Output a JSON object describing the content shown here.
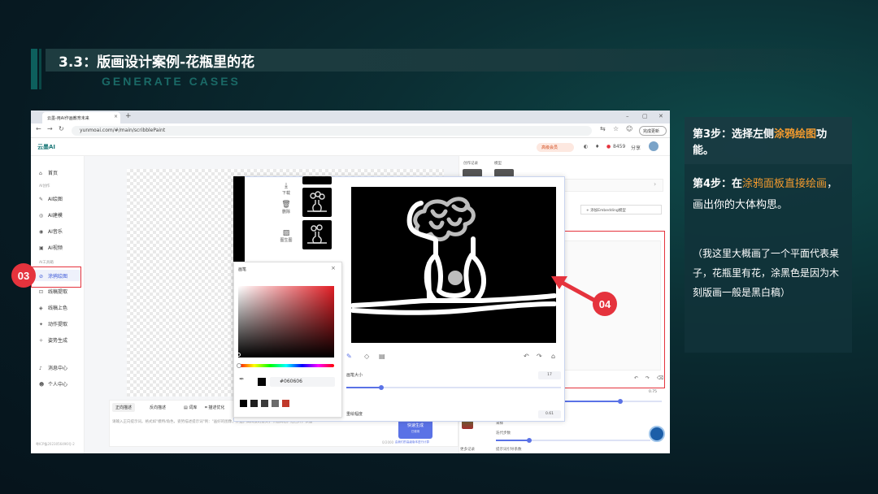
{
  "slide": {
    "title": "3.3：版画设计案例-花瓶里的花",
    "subtitle": "GENERATE CASES"
  },
  "browser": {
    "tab_title": "云墨-用AI作画教育未来",
    "tab_close": "×",
    "new_tab": "+",
    "url": "yunmoai.com/#/main/scribblePaint",
    "profile_button": "完成更新"
  },
  "app": {
    "logo": "云墨AI",
    "vip_button": "高级会员",
    "points": "8459",
    "share": "分享"
  },
  "sidebar": {
    "home": "首页",
    "group_ai_create": "AI创作",
    "items_create": [
      "AI绘图",
      "AI建模",
      "AI音乐",
      "AI视频"
    ],
    "group_ai_tools": "AI工具箱",
    "items_tools": [
      "涂鸦绘图",
      "线稿提取",
      "线稿上色",
      "动作提取",
      "姿势生成"
    ],
    "messages": "消息中心",
    "profile": "个人中心",
    "footer": "粤ICP备2023056496号-2"
  },
  "prompt": {
    "tab_positive": "正向描述",
    "tab_negative": "反向描述",
    "tab_words": "词库",
    "tab_suggest": "描述优化",
    "placeholder": "请输入正向提示词。格式如\"模特/角色，姿势描述提示词\"例：\"画好的图像，外边，高科技的街头，卡通风格，红色外，衣服\"",
    "counter": "0/2000",
    "generate_button": "快速生成",
    "generate_sub": "已使用",
    "generate_hint": "由我们的高级版本进行计算"
  },
  "right_panel": {
    "label_records": "创作记录",
    "label_model": "模型",
    "embed_button": "+ 添加Embedding模型",
    "value_075": "0.75",
    "label_more": "更多记录",
    "label_sampler": "采样",
    "label_steps": "迭代步数",
    "label_guidance": "提示词引导系数"
  },
  "modal": {
    "tool_download": "下载",
    "tool_delete": "删除",
    "tool_generate": "图生图",
    "brush_size_label": "画笔大小",
    "brush_size_value": "17",
    "redraw_label": "重绘幅度",
    "redraw_value": "0.61"
  },
  "color_picker": {
    "title": "画笔",
    "close": "×",
    "hex": "#060606",
    "presets": [
      "#000000",
      "#1f1f1f",
      "#3a3a3a",
      "#6b6b6b",
      "#c0392b"
    ]
  },
  "annotations": {
    "label_03": "03",
    "label_04": "04"
  },
  "instructions": {
    "step3_prefix": "第3步：选择左侧",
    "step3_highlight": "涂鸦绘图",
    "step3_suffix": "功能。",
    "step4_prefix": "第4步：在",
    "step4_highlight": "涂鸦面板直接绘画",
    "step4_suffix": "，画出你的大体构思。",
    "note": "（我这里大概画了一个平面代表桌子，花瓶里有花，涂黑色是因为木刻版画一般是黑白稿）"
  },
  "colors": {
    "accent_red": "#e5333d",
    "highlight_orange": "#f29a2e",
    "primary_blue": "#5a72e6",
    "teal": "#0d5f5d"
  }
}
